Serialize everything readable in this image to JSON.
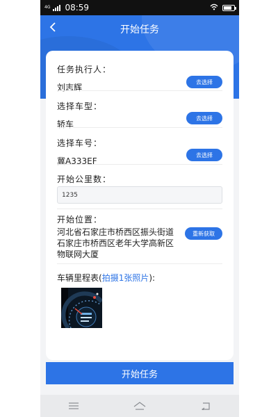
{
  "status_bar": {
    "network": "4G",
    "time": "08:59",
    "battery_level": 0.8
  },
  "header": {
    "title": "开始任务"
  },
  "form": {
    "executor": {
      "label": "任务执行人：",
      "value": "刘志辉",
      "button": "去选择"
    },
    "vehicle_type": {
      "label": "选择车型：",
      "value": "轿车",
      "button": "去选择"
    },
    "plate": {
      "label": "选择车号：",
      "value": "冀A333EF",
      "button": "去选择"
    },
    "start_km": {
      "label": "开始公里数：",
      "value": "1235"
    },
    "start_location": {
      "label": "开始位置：",
      "value": "河北省石家庄市桥西区振头街道石家庄市桥西区老年大学高新区物联网大厦",
      "button": "重新获取"
    },
    "odometer": {
      "label": "车辆里程表(",
      "link": "拍摄1张照片",
      "label_end": "):"
    }
  },
  "submit": {
    "label": "开始任务"
  },
  "colors": {
    "primary": "#2d74e6"
  }
}
